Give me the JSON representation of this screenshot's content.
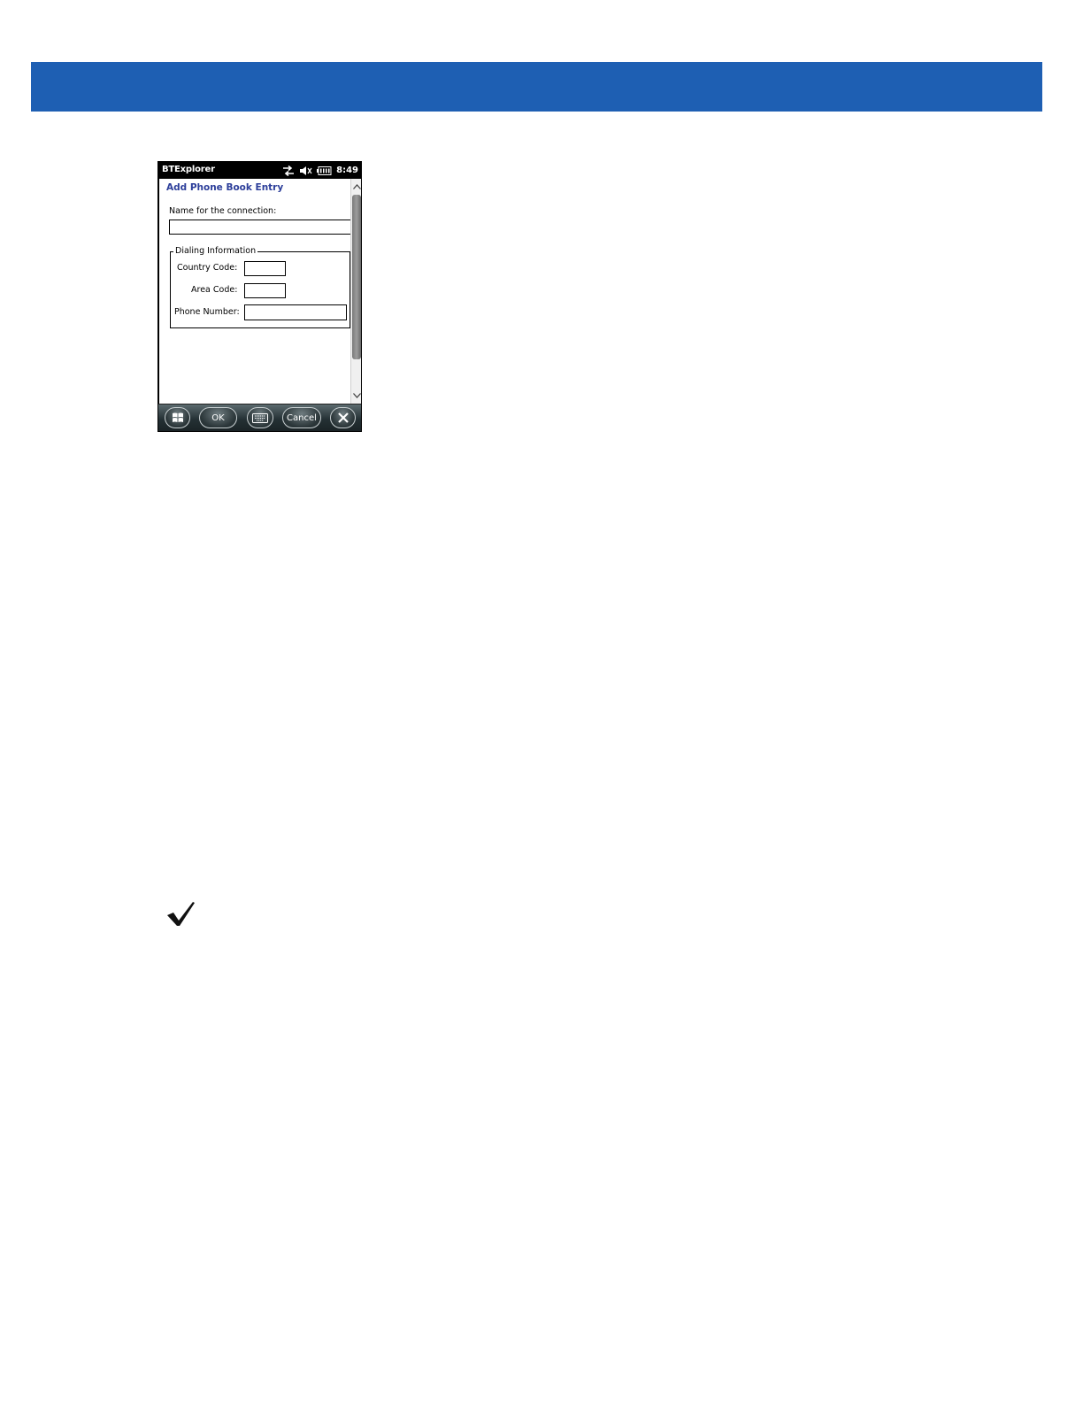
{
  "status_bar": {
    "app_title": "BTExplorer",
    "time": "8:49"
  },
  "form": {
    "heading": "Add Phone Book Entry",
    "name_label": "Name for the connection:",
    "name_value": "",
    "group_title": "Dialing Information",
    "country_code_label": "Country Code:",
    "country_code_value": "",
    "area_code_label": "Area Code:",
    "area_code_value": "",
    "phone_number_label": "Phone Number:",
    "phone_number_value": ""
  },
  "taskbar": {
    "ok_label": "OK",
    "cancel_label": "Cancel"
  },
  "colors": {
    "header_bar": "#1e5fb3",
    "heading_text": "#2c3e9a"
  },
  "icons": {
    "status": [
      "sync-arrows-icon",
      "speaker-muted-icon",
      "battery-icon"
    ],
    "taskbar": [
      "windows-start-icon",
      "keyboard-icon",
      "close-icon"
    ],
    "note": "checkmark-icon"
  }
}
